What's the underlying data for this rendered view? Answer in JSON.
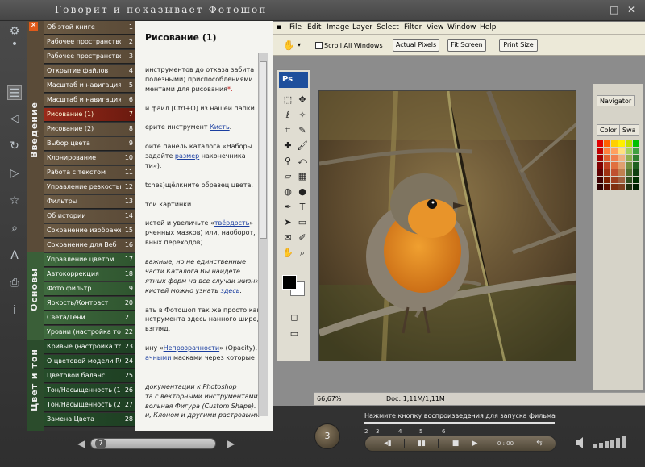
{
  "app": {
    "title": "Говорит и показывает Фотошоп",
    "window_buttons": [
      "_",
      "□",
      "✕"
    ]
  },
  "sections": [
    "Введение",
    "Основы",
    "Цвет и тон"
  ],
  "toc": [
    {
      "label": "Об этой книге",
      "num": "1",
      "group": "brown"
    },
    {
      "label": "Рабочее пространство",
      "num": "2",
      "group": "brown"
    },
    {
      "label": "Рабочее пространство",
      "num": "3",
      "group": "brown"
    },
    {
      "label": "Открытие файлов",
      "num": "4",
      "group": "brown"
    },
    {
      "label": "Масштаб и навигация (1",
      "num": "5",
      "group": "brown"
    },
    {
      "label": "Масштаб и навигация (2",
      "num": "6",
      "group": "brown"
    },
    {
      "label": "Рисование (1)",
      "num": "7",
      "group": "active"
    },
    {
      "label": "Рисование (2)",
      "num": "8",
      "group": "brown"
    },
    {
      "label": "Выбор цвета",
      "num": "9",
      "group": "brown"
    },
    {
      "label": "Клонирование",
      "num": "10",
      "group": "brown"
    },
    {
      "label": "Работа с текстом",
      "num": "11",
      "group": "brown"
    },
    {
      "label": "Управление резкостью",
      "num": "12",
      "group": "brown"
    },
    {
      "label": "Фильтры",
      "num": "13",
      "group": "brown"
    },
    {
      "label": "Об истории",
      "num": "14",
      "group": "brown"
    },
    {
      "label": "Сохранение изображен",
      "num": "15",
      "group": "brown"
    },
    {
      "label": "Сохранение для Веб",
      "num": "16",
      "group": "brown"
    },
    {
      "label": "Управление цветом",
      "num": "17",
      "group": "green"
    },
    {
      "label": "Автокоррекция",
      "num": "18",
      "group": "green"
    },
    {
      "label": "Фото фильтр",
      "num": "19",
      "group": "green"
    },
    {
      "label": "Яркость/Контраст",
      "num": "20",
      "group": "green"
    },
    {
      "label": "Света/Тени",
      "num": "21",
      "group": "green"
    },
    {
      "label": "Уровни (настройка тон",
      "num": "22",
      "group": "green"
    },
    {
      "label": "Кривые (настройка тон",
      "num": "23",
      "group": "dark"
    },
    {
      "label": "О цветовой модели RGI",
      "num": "24",
      "group": "dark"
    },
    {
      "label": "Цветовой баланс",
      "num": "25",
      "group": "dark"
    },
    {
      "label": "Тон/Насыщенность (1)",
      "num": "26",
      "group": "dark"
    },
    {
      "label": "Тон/Насыщенность (2)",
      "num": "27",
      "group": "dark"
    },
    {
      "label": "Замена Цвета",
      "num": "28",
      "group": "dark"
    }
  ],
  "text_panel": {
    "heading": "Рисование (1)",
    "lines": [
      {
        "t": "инструментов до отказа забита",
        "i": false
      },
      {
        "t": "полезными) приспособлениями.",
        "i": false
      },
      {
        "t": "ментами для рисования",
        "i": false,
        "mark": "*."
      },
      {
        "t": "",
        "i": false
      },
      {
        "t": "й файл [Ctrl+O] из нашей папки.",
        "i": false
      },
      {
        "t": "",
        "i": false
      },
      {
        "t": "ерите инструмент ",
        "i": false,
        "link": "Кисть",
        "after": "."
      },
      {
        "t": "",
        "i": false
      },
      {
        "t": "ойте панель каталога «Наборы",
        "i": false
      },
      {
        "t": "задайте ",
        "i": false,
        "link": "размер",
        "after": " наконечника"
      },
      {
        "t": "ти»).",
        "i": false
      },
      {
        "t": "",
        "i": false
      },
      {
        "t": "tches)щёлкните образец цвета,",
        "i": false
      },
      {
        "t": "",
        "i": false
      },
      {
        "t": "той картинки.",
        "i": false
      },
      {
        "t": "",
        "i": false
      },
      {
        "t": "истей и увеличьте «",
        "i": false,
        "link": "твёрдость",
        "after": "»"
      },
      {
        "t": "рченных мазков) или, наоборот,",
        "i": false
      },
      {
        "t": "вных переходов).",
        "i": false
      },
      {
        "t": "",
        "i": false
      },
      {
        "t": "важные, но не единственные",
        "i": true
      },
      {
        "t": "части Каталога Вы найдете",
        "i": true
      },
      {
        "t": "ятных форм на все случаи жизни.",
        "i": true
      },
      {
        "t": "кистей можно узнать ",
        "i": true,
        "link": "здесь",
        "after": "."
      },
      {
        "t": "",
        "i": false
      },
      {
        "t": "ать в Фотошоп так же просто как",
        "i": false
      },
      {
        "t": "нструмента здесь нанного шире,",
        "i": false
      },
      {
        "t": "взгляд.",
        "i": false
      },
      {
        "t": "",
        "i": false
      },
      {
        "t": "ину «",
        "i": false,
        "link": "Непрозрачности",
        "after": "» (Opacity),"
      },
      {
        "t": "",
        "i": false,
        "link": "ачными",
        "after": " масками через которые"
      },
      {
        "t": "",
        "i": false
      },
      {
        "t": "",
        "i": false
      },
      {
        "t": "документации к Photoshop",
        "i": true
      },
      {
        "t": "та с векторными инструментами,",
        "i": true
      },
      {
        "t": "вольная Фигура (Custom Shape).",
        "i": true
      },
      {
        "t": "и, Клоном и другими растровыми",
        "i": true
      }
    ]
  },
  "photoshop": {
    "menu": [
      "File",
      "Edit",
      "Image",
      "Layer",
      "Select",
      "Filter",
      "View",
      "Window",
      "Help"
    ],
    "scroll_all_windows": "Scroll All Windows",
    "actual_pixels": "Actual Pixels",
    "fit_screen": "Fit Screen",
    "print_size": "Print Size",
    "logo": "Ps",
    "zoom": "66,67%",
    "doc_info": "Doc: 1,11M/1,11M",
    "panels": {
      "navigator": "Navigator",
      "color": "Color",
      "swatches": "Swa"
    },
    "colors": {
      "fg": "#000000",
      "bg": "#ffffff"
    }
  },
  "player": {
    "hint_before": "Нажмите кнопку ",
    "hint_link": "воспроизведения",
    "hint_after": " для запуска фильма",
    "steps": [
      "2",
      "3",
      "4",
      "5",
      "6"
    ],
    "time": "0 : 00",
    "page_num": "7",
    "round_button": "3"
  }
}
